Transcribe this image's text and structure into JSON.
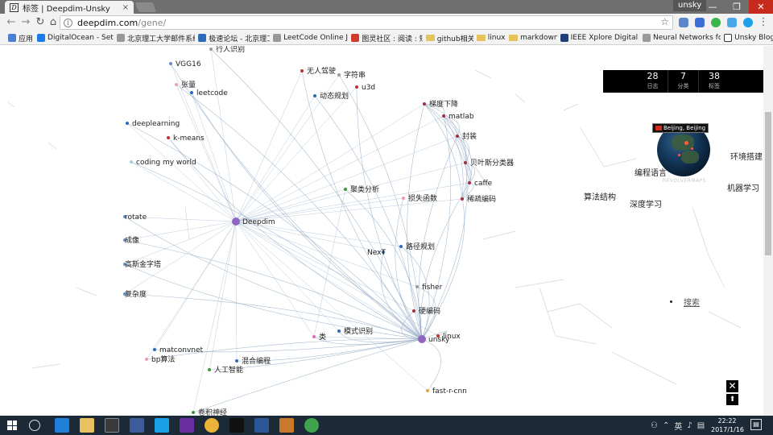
{
  "browser": {
    "tab_title": "标签 | Deepdim-Unsky",
    "tab_favicon": "D",
    "tab_close": "×",
    "user_name": "unsky",
    "url_host": "deepdim.com",
    "url_path": "/gene/",
    "window_controls": [
      "—",
      "❐",
      "✕"
    ],
    "bookmarks": [
      {
        "label": "应用",
        "icon": "apps-icon",
        "color": "#4a7fd6"
      },
      {
        "label": "DigitalOcean - Setti",
        "icon": "digitalocean-icon",
        "color": "#1a7ae8"
      },
      {
        "label": "北京理工大学邮件系统",
        "icon": "page-icon",
        "color": "#999999"
      },
      {
        "label": "极速论坛 - 北京理工",
        "icon": "forum-icon",
        "color": "#2a6ab8"
      },
      {
        "label": "LeetCode Online Ju",
        "icon": "page-icon",
        "color": "#999999"
      },
      {
        "label": "图灵社区 : 阅读 : 短",
        "icon": "p-icon",
        "color": "#d23b2b"
      },
      {
        "label": "github相关",
        "icon": "folder-icon",
        "color": "#e7c35b"
      },
      {
        "label": "linux",
        "icon": "folder-icon",
        "color": "#e7c35b"
      },
      {
        "label": "markdown",
        "icon": "folder-icon",
        "color": "#e7c35b"
      },
      {
        "label": "IEEE Xplore Digital L",
        "icon": "ieee-icon",
        "color": "#1f3f7a"
      },
      {
        "label": "Neural Networks for",
        "icon": "page-icon",
        "color": "#999999"
      },
      {
        "label": "Unsky Blog",
        "icon": "d-icon",
        "color": "#ffffff"
      }
    ]
  },
  "stats": [
    {
      "value": "28",
      "label": "日志"
    },
    {
      "value": "7",
      "label": "分类"
    },
    {
      "value": "38",
      "label": "标签"
    }
  ],
  "globe": {
    "location": "Beijing, Beijing",
    "brand": "REVOLVERMAPS"
  },
  "categories": [
    {
      "label": "环境搭建"
    },
    {
      "label": "编程语言"
    },
    {
      "label": "机器学习"
    },
    {
      "label": "算法结构"
    },
    {
      "label": "深度学习"
    }
  ],
  "search_label": "搜索",
  "controls": {
    "close": "✕",
    "top": "⬆"
  },
  "graph": {
    "nodes": [
      {
        "id": "deepdim",
        "label": "Deepdim",
        "color": "#8e67c2",
        "big": true
      },
      {
        "id": "unsky",
        "label": "unsky",
        "color": "#8e67c2",
        "big": true
      },
      {
        "id": "lei",
        "label": "类",
        "color": "#e06fb8"
      },
      {
        "id": "juleifenxi",
        "label": "聚类分析",
        "color": "#3b9b3b"
      },
      {
        "id": "rengongzhineng",
        "label": "人工智能",
        "color": "#3b9b3b"
      },
      {
        "id": "xingrenshibie",
        "label": "行人识别",
        "color": "#9a9a9a"
      },
      {
        "id": "vgg16",
        "label": "VGG16",
        "color": "#5b8fd0"
      },
      {
        "id": "zhangliang",
        "label": "张量",
        "color": "#e8a0b0"
      },
      {
        "id": "leetcode",
        "label": "leetcode",
        "color": "#2a6ab8"
      },
      {
        "id": "deeplearning",
        "label": "deeplearning",
        "color": "#2a6ab8"
      },
      {
        "id": "kmeans",
        "label": "k-means",
        "color": "#c03030"
      },
      {
        "id": "codingmyworld",
        "label": "coding my world",
        "color": "#a0d0e0"
      },
      {
        "id": "rotate",
        "label": "rotate",
        "color": "#5b8fd0"
      },
      {
        "id": "chengxiang",
        "label": "成像",
        "color": "#5b8fd0"
      },
      {
        "id": "jinzita",
        "label": "高斯金字塔",
        "color": "#5b8fd0"
      },
      {
        "id": "fuzadu",
        "label": "复杂度",
        "color": "#5b8fd0"
      },
      {
        "id": "matconvnet",
        "label": "matconvnet",
        "color": "#2a6ab8"
      },
      {
        "id": "bpsuanfa",
        "label": "bp算法",
        "color": "#e8a0b0"
      },
      {
        "id": "hunhebiancheng",
        "label": "混合编程",
        "color": "#2a6ab8"
      },
      {
        "id": "juanjishenjing",
        "label": "卷积神经",
        "color": "#3b9b3b"
      },
      {
        "id": "wurenjiashi",
        "label": "无人驾驶",
        "color": "#c03030"
      },
      {
        "id": "zifuchuan",
        "label": "字符串",
        "color": "#9a9a9a"
      },
      {
        "id": "u3d",
        "label": "u3d",
        "color": "#c03030"
      },
      {
        "id": "dongtaiguihua",
        "label": "动态规划",
        "color": "#2a6ab8"
      },
      {
        "id": "tiduxiajiang",
        "label": "梯度下降",
        "color": "#a03040"
      },
      {
        "id": "matlab",
        "label": "matlab",
        "color": "#a03040"
      },
      {
        "id": "fengzhuang",
        "label": "封装",
        "color": "#a03040"
      },
      {
        "id": "beiyesi",
        "label": "贝叶斯分类器",
        "color": "#a03040"
      },
      {
        "id": "caffe",
        "label": "caffe",
        "color": "#a03040"
      },
      {
        "id": "xishubianma",
        "label": "稀疏编码",
        "color": "#a03040"
      },
      {
        "id": "sunshihanshu",
        "label": "损失函数",
        "color": "#e8a0b0"
      },
      {
        "id": "lujingguihua",
        "label": "路径规划",
        "color": "#2a6ab8"
      },
      {
        "id": "next",
        "label": "NexT",
        "color": "#2a6ab8"
      },
      {
        "id": "fisher",
        "label": "fisher",
        "color": "#9a9a9a"
      },
      {
        "id": "yingbianma",
        "label": "硬编码",
        "color": "#a03040"
      },
      {
        "id": "linux",
        "label": "linux",
        "color": "#c03030"
      },
      {
        "id": "moshishibie",
        "label": "模式识别",
        "color": "#2a6ab8"
      },
      {
        "id": "fastrcnn",
        "label": "fast-r-cnn",
        "color": "#f0a040"
      }
    ]
  }
}
